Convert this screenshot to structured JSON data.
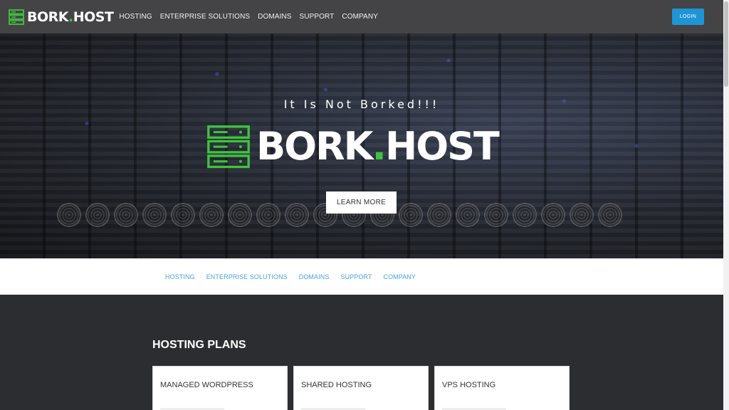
{
  "header": {
    "brand": {
      "name": "BORK",
      "dot": ".",
      "tld": "HOST"
    },
    "nav": [
      "HOSTING",
      "ENTERPRISE SOLUTIONS",
      "DOMAINS",
      "SUPPORT",
      "COMPANY"
    ],
    "login_label": "LOGIN"
  },
  "hero": {
    "tagline": "It Is Not Borked!!!",
    "logo": {
      "name": "BORK",
      "dot": ".",
      "tld": "HOST"
    },
    "cta_label": "LEARN MORE"
  },
  "subnav": [
    "HOSTING",
    "ENTERPRISE SOLUTIONS",
    "DOMAINS",
    "SUPPORT",
    "COMPANY"
  ],
  "plans": {
    "title": "HOSTING PLANS",
    "cards": [
      {
        "title": "MANAGED WORDPRESS"
      },
      {
        "title": "SHARED HOSTING"
      },
      {
        "title": "VPS HOSTING"
      }
    ]
  },
  "colors": {
    "accent_green": "#3fc33f",
    "login_blue": "#1e95d6",
    "link_blue": "#4aa3d8",
    "nav_bg": "#444446",
    "section_bg": "#2b2d30"
  },
  "icons": {
    "brand": "server-rack-icon"
  }
}
